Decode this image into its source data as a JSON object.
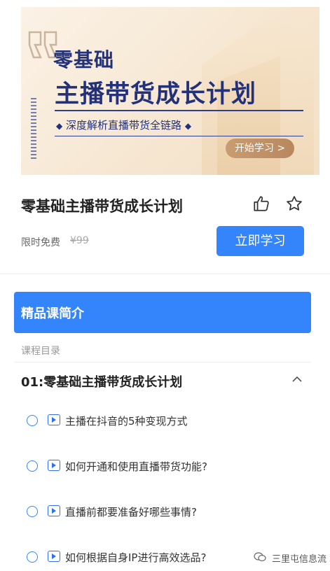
{
  "banner": {
    "line1": "零基础",
    "line2": "主播带货成长计划",
    "subtitle": "深度解析直播带货全链路",
    "cta": "开始学习 >"
  },
  "course": {
    "title": "零基础主播带货成长计划",
    "price_label": "限时免费",
    "original_price": "¥99",
    "study_button": "立即学习"
  },
  "intro": {
    "title": "精品课简介"
  },
  "catalog": {
    "label": "课程目录",
    "chapter": "01:零基础主播带货成长计划",
    "lessons": [
      "主播在抖音的5种变现方式",
      "如何开通和使用直播带货功能?",
      "直播前都要准备好哪些事情?",
      "如何根据自身IP进行高效选品?"
    ]
  },
  "watermark": {
    "text": "三里屯信息流"
  },
  "colors": {
    "primary": "#3485fb",
    "banner_text": "#23317a",
    "banner_button": "#c99c72"
  },
  "icons": [
    "quote-icon",
    "thumbs-up-icon",
    "star-icon",
    "chevron-up-icon",
    "play-icon",
    "wechat-icon"
  ]
}
